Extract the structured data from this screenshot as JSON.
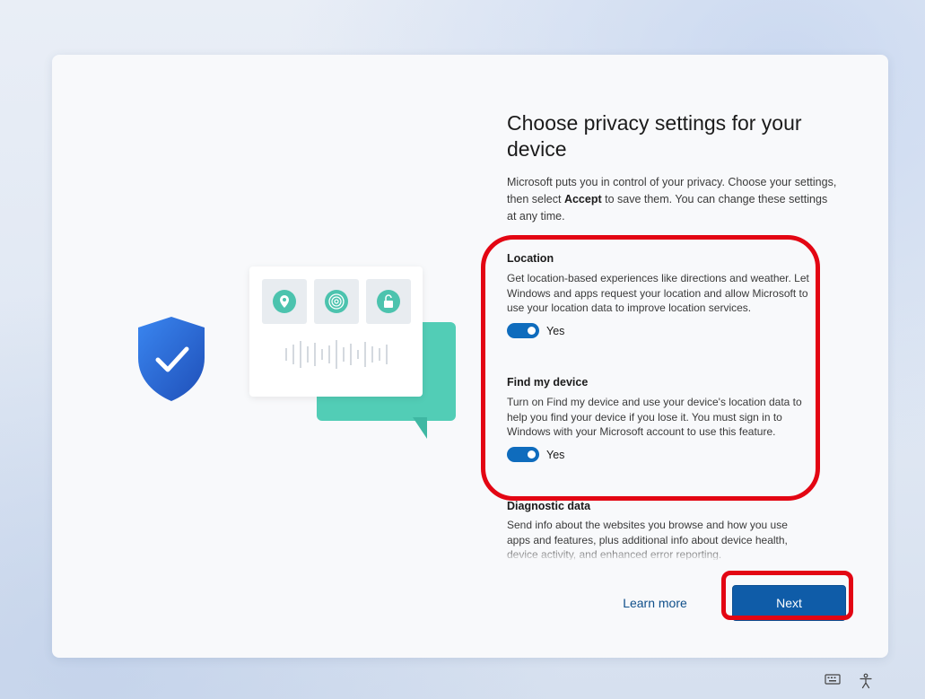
{
  "window": {
    "title": "Choose privacy settings for your device",
    "intro_part1": "Microsoft puts you in control of your privacy. Choose your settings, then select ",
    "intro_bold": "Accept",
    "intro_part2": " to save them. You can change these settings at any time."
  },
  "settings": [
    {
      "title": "Location",
      "description": "Get location-based experiences like directions and weather. Let Windows and apps request your location and allow Microsoft to use your location data to improve location services.",
      "toggle_state": "on",
      "toggle_label": "Yes"
    },
    {
      "title": "Find my device",
      "description": "Turn on Find my device and use your device's location data to help you find your device if you lose it. You must sign in to Windows with your Microsoft account to use this feature.",
      "toggle_state": "on",
      "toggle_label": "Yes"
    },
    {
      "title": "Diagnostic data",
      "description": "Send info about the websites you browse and how you use apps and features, plus additional info about device health, device activity, and enhanced error reporting."
    }
  ],
  "footer": {
    "learn_more": "Learn more",
    "next": "Next"
  },
  "colors": {
    "accent": "#0f5ca8",
    "toggle_on": "#0f6cbd",
    "annotation": "#e30613",
    "illustration_teal": "#52cdb6",
    "shield_blue": "#2d6fd6"
  },
  "icons": {
    "tiles": [
      "location-pin-icon",
      "fingerprint-icon",
      "unlock-icon"
    ],
    "shield": "shield-check-icon",
    "system": [
      "keyboard-icon",
      "accessibility-icon"
    ]
  }
}
